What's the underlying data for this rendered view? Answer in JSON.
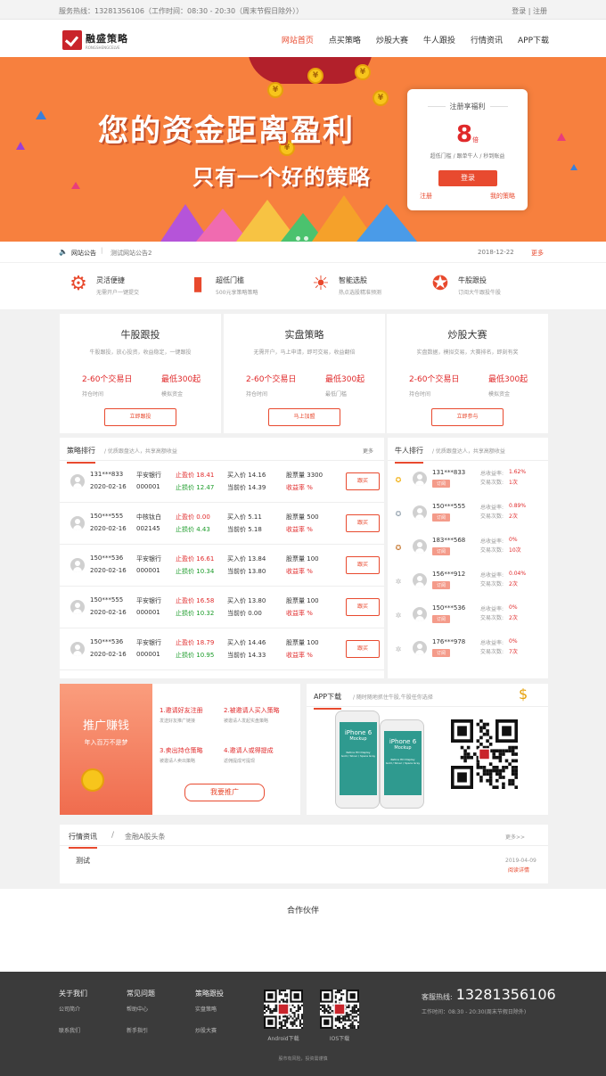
{
  "topbar": {
    "hotline": "服务热线：13281356106（工作时间：08:30 - 20:30（周末节假日除外））",
    "login": "登录",
    "sep": "|",
    "register": "注册"
  },
  "logo": {
    "name": "融盛策略",
    "sub": "RONGSHENGCELVE"
  },
  "nav": [
    "网站首页",
    "点买策略",
    "炒股大赛",
    "牛人跟投",
    "行情资讯",
    "APP下载"
  ],
  "banner": {
    "slogan1": "您的资金距离盈利",
    "slogan2": "只有一个好的策略",
    "coin_glyph": "¥"
  },
  "regbox": {
    "title": "注册享福利",
    "num": "8",
    "unit": "倍",
    "desc": "超低门槛 / 跟单牛人 / 秒到账益",
    "btn": "登录",
    "link1": "注册",
    "link2": "我的策略"
  },
  "notice": {
    "label": "网站公告",
    "sep": "|",
    "content": "测试网站公告2",
    "date": "2018-12-22",
    "more": "更多"
  },
  "features": [
    {
      "icon": "gear-icon",
      "glyph": "⚙",
      "title": "灵活便捷",
      "desc": "无需开户一键提交"
    },
    {
      "icon": "door-icon",
      "glyph": "▮",
      "title": "超低门槛",
      "desc": "500元享策略策略"
    },
    {
      "icon": "bulb-icon",
      "glyph": "☀",
      "title": "智能选股",
      "desc": "热点选股精准预测"
    },
    {
      "icon": "medal-icon",
      "glyph": "✪",
      "title": "牛股跟投",
      "desc": "订阅大牛跟投牛股"
    }
  ],
  "cards": [
    {
      "title": "牛股跟投",
      "desc": "牛股跟投，放心投资，收益稳定，一键跟投",
      "v1": "2-60个交易日",
      "v2": "最低300起",
      "l1": "持仓时间",
      "l2": "模拟资金",
      "btn": "立即跟投"
    },
    {
      "title": "实盘策略",
      "desc": "无需开户，马上申请，即可交易，收益翻倍",
      "v1": "2-60个交易日",
      "v2": "最低300起",
      "l1": "持仓时间",
      "l2": "最低门槛",
      "btn": "马上加盟"
    },
    {
      "title": "炒股大赛",
      "desc": "实盘数据，模拟交易，大赛排名，即刻有奖",
      "v1": "2-60个交易日",
      "v2": "最低300起",
      "l1": "持仓时间",
      "l2": "模拟资金",
      "btn": "立即参与"
    }
  ],
  "strategy": {
    "title": "策略排行",
    "desc": "/ 优质跟盘达人，共享高额收益",
    "more": "更多",
    "labels": {
      "stop_profit": "止盈价",
      "stop_loss": "止损价",
      "buy": "买入价",
      "cur": "当前价",
      "qty": "股票量",
      "rate": "收益率"
    },
    "pct": "%",
    "btn": "跟买",
    "rows": [
      {
        "user": "131***833",
        "date": "2020-02-16",
        "stock": "平安银行",
        "code": "000001",
        "sp": "18.41",
        "sl": "12.47",
        "buy": "14.16",
        "cur": "14.39",
        "qty": "3300"
      },
      {
        "user": "150***555",
        "date": "2020-02-16",
        "stock": "中核钛白",
        "code": "002145",
        "sp": "0.00",
        "sl": "4.43",
        "buy": "5.11",
        "cur": "5.18",
        "qty": "500"
      },
      {
        "user": "150***536",
        "date": "2020-02-16",
        "stock": "平安银行",
        "code": "000001",
        "sp": "16.61",
        "sl": "10.34",
        "buy": "13.84",
        "cur": "13.80",
        "qty": "100"
      },
      {
        "user": "150***555",
        "date": "2020-02-16",
        "stock": "平安银行",
        "code": "000001",
        "sp": "16.58",
        "sl": "10.32",
        "buy": "13.80",
        "cur": "0.00",
        "qty": "100"
      },
      {
        "user": "150***536",
        "date": "2020-02-16",
        "stock": "平安银行",
        "code": "000001",
        "sp": "18.79",
        "sl": "10.95",
        "buy": "14.46",
        "cur": "14.33",
        "qty": "100"
      }
    ]
  },
  "ranking": {
    "title": "牛人排行",
    "desc": "/ 优质跟盘达人，共享高额收益",
    "tag": "订阅",
    "l1": "总收益率:",
    "l2": "交易次数:",
    "rows": [
      {
        "user": "131***833",
        "rate": "1.62%",
        "times": "1次"
      },
      {
        "user": "150***555",
        "rate": "0.89%",
        "times": "2次"
      },
      {
        "user": "183***568",
        "rate": "0%",
        "times": "10次"
      },
      {
        "user": "156***912",
        "rate": "0.04%",
        "times": "2次"
      },
      {
        "user": "150***536",
        "rate": "0%",
        "times": "2次"
      },
      {
        "user": "176***978",
        "rate": "0%",
        "times": "7次"
      }
    ]
  },
  "promo": {
    "title": "推广赚钱",
    "sub": "年入百万不是梦",
    "steps": [
      {
        "t": "1.邀请好友注册",
        "d": "发送好友推广链接"
      },
      {
        "t": "2.被邀请人买入策略",
        "d": "被邀请人发起实盘策略"
      },
      {
        "t": "3.卖出持仓策略",
        "d": "被邀请人卖出策略"
      },
      {
        "t": "4.邀请人或得提成",
        "d": "返佣提成可提现"
      }
    ],
    "btn": "我要推广"
  },
  "app": {
    "title": "APP下载",
    "desc": "/ 随时随地抓住牛股,牛股任你选择",
    "phone": "iPhone 6",
    "mock": "Mockup",
    "mock_line1": "Retina HD Display",
    "mock_line2": "Gold / Silver / Space Gray"
  },
  "news": {
    "tab1": "行情资讯",
    "sep": "/",
    "tab2": "金融A股头条",
    "more": "更多>>",
    "item": "测试",
    "date": "2019-04-09",
    "read": "阅读详情"
  },
  "partner": "合作伙伴",
  "footer": {
    "cols": [
      {
        "h": "关于我们",
        "a": "公司简介",
        "b": "联系我们"
      },
      {
        "h": "常见问题",
        "a": "帮助中心",
        "b": "新手指引"
      },
      {
        "h": "策略跟投",
        "a": "实盘策略",
        "b": "炒股大赛"
      }
    ],
    "android": "Android下载",
    "ios": "IOS下载",
    "hot_label": "客服热线:",
    "hot": "13281356106",
    "hours": "工作时间：08:30 - 20:30(周末节假日除外)",
    "copy": "股市有风险，投资需谨慎"
  },
  "colors": {
    "accent": "#e84a2f",
    "banner": "#f7803e",
    "up": "#e0292a",
    "down": "#1a9b28"
  }
}
